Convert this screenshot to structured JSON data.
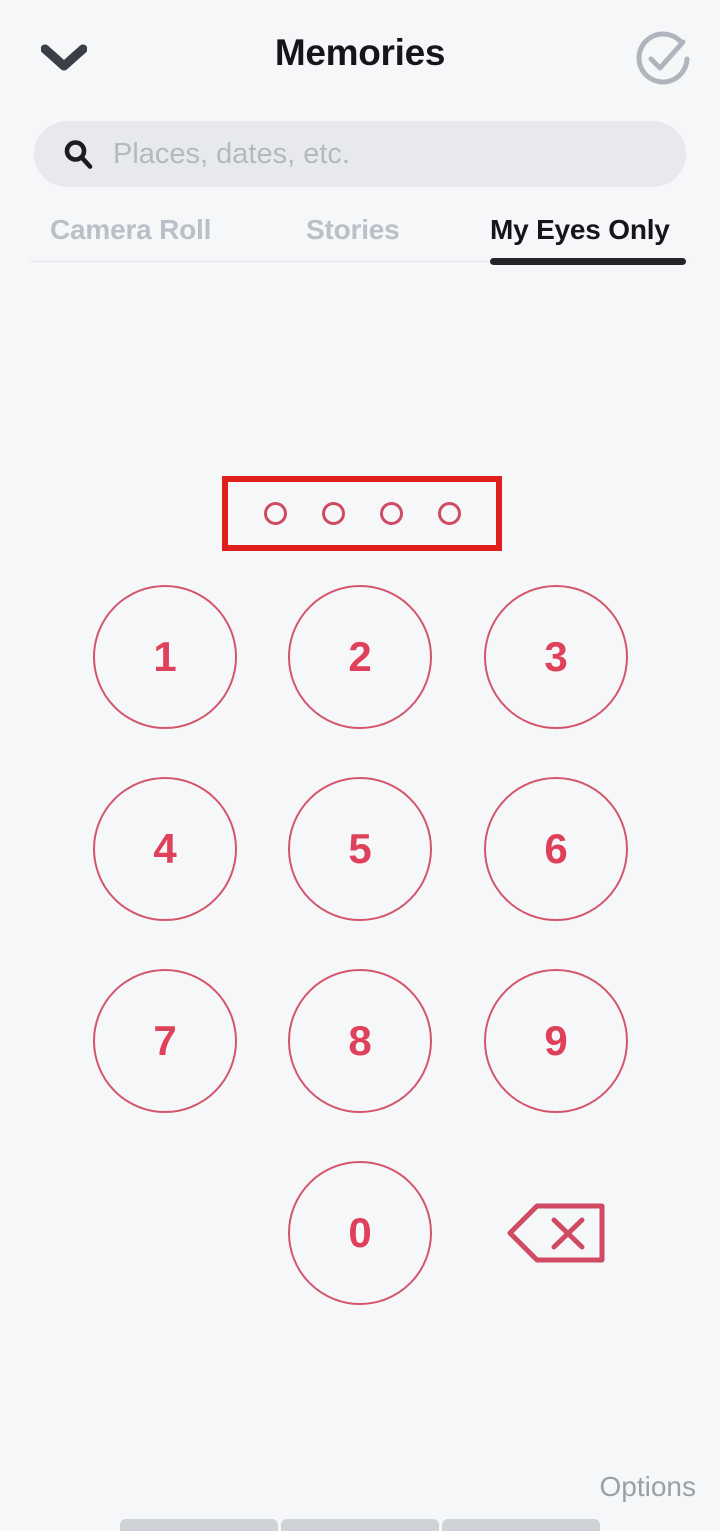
{
  "header": {
    "title": "Memories",
    "back_icon": "chevron-down-icon",
    "select_icon": "check-circle-icon"
  },
  "search": {
    "placeholder": "Places, dates, etc.",
    "value": "",
    "icon": "search-icon"
  },
  "tabs": [
    {
      "label": "Camera Roll",
      "active": false
    },
    {
      "label": "Stories",
      "active": false
    },
    {
      "label": "My Eyes Only",
      "active": true
    }
  ],
  "passcode": {
    "length": 4,
    "entered": 0,
    "dots": [
      {
        "filled": false
      },
      {
        "filled": false
      },
      {
        "filled": false
      },
      {
        "filled": false
      }
    ],
    "highlight": {
      "visible": true,
      "color": "#e01f1f"
    }
  },
  "keypad": {
    "keys": [
      {
        "label": "1",
        "row": 0,
        "col": 0
      },
      {
        "label": "2",
        "row": 0,
        "col": 1
      },
      {
        "label": "3",
        "row": 0,
        "col": 2
      },
      {
        "label": "4",
        "row": 1,
        "col": 0
      },
      {
        "label": "5",
        "row": 1,
        "col": 1
      },
      {
        "label": "6",
        "row": 1,
        "col": 2
      },
      {
        "label": "7",
        "row": 2,
        "col": 0
      },
      {
        "label": "8",
        "row": 2,
        "col": 1
      },
      {
        "label": "9",
        "row": 2,
        "col": 2
      },
      {
        "label": "0",
        "row": 3,
        "col": 1
      }
    ],
    "backspace_icon": "backspace-delete-icon"
  },
  "footer": {
    "options_label": "Options"
  },
  "colors": {
    "background": "#f6f7f9",
    "accent_red": "#e0415a",
    "key_border": "#d4566c",
    "highlight": "#e01f1f",
    "title": "#15161a",
    "tab_inactive": "#bbbfc7",
    "search_bg": "#e7e9ed",
    "placeholder": "#b4b8bf",
    "options": "#9aa0a9"
  }
}
